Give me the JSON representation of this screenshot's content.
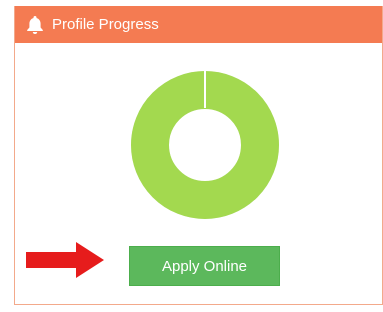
{
  "card": {
    "title": "Profile Progress",
    "icon": "bell-icon",
    "header_color": "#f47b52"
  },
  "progress": {
    "percent": 100,
    "fill_color": "#a3d94f"
  },
  "actions": {
    "apply_label": "Apply Online",
    "apply_color": "#5cb85c",
    "pointer_icon": "arrow-right-icon",
    "pointer_color": "#e61c1c"
  }
}
